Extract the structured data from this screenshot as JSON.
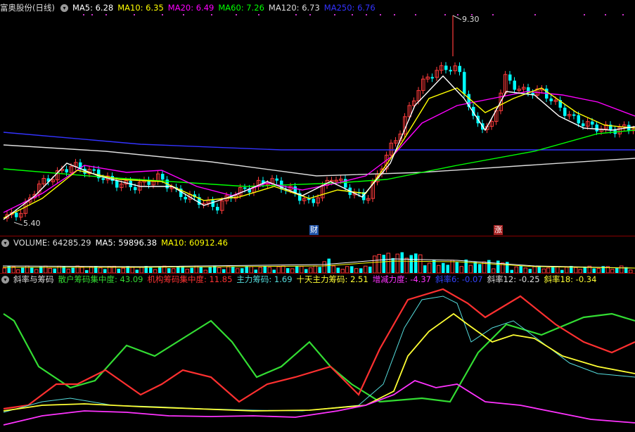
{
  "stock": {
    "title": "富奥股份(日线)"
  },
  "price_panel": {
    "toggle": "▾",
    "ma": [
      {
        "label": "MA5: 6.28",
        "color": "#ffffff"
      },
      {
        "label": "MA10: 6.35",
        "color": "#ffff00"
      },
      {
        "label": "MA20: 6.49",
        "color": "#ff00ff"
      },
      {
        "label": "MA60: 7.26",
        "color": "#00ff00"
      },
      {
        "label": "MA120: 6.73",
        "color": "#dddddd"
      },
      {
        "label": "MA250: 6.76",
        "color": "#3333ff"
      }
    ],
    "high_label": "9.30",
    "low_label": "5.40",
    "marker_cai": "财",
    "marker_zhang": "涨"
  },
  "volume_panel": {
    "label": "VOLUME: 64285.29",
    "ma5": "MA5: 59896.38",
    "ma10": "MA10: 60912.46"
  },
  "indicator_panel": {
    "name": "斜率与筹码",
    "items": [
      {
        "label": "散户筹码集中度: 43.09",
        "color": "#33dd33"
      },
      {
        "label": "机构筹码集中度: 11.85",
        "color": "#ff3030"
      },
      {
        "label": "主力筹码: 1.69",
        "color": "#55dddd"
      },
      {
        "label": "十天主力筹码: 2.51",
        "color": "#ffff33"
      },
      {
        "label": "增减力度: -4.37",
        "color": "#ff33ff"
      },
      {
        "label": "斜率6: -0.07",
        "color": "#3344ff"
      },
      {
        "label": "斜率12: -0.25",
        "color": "#dddddd"
      },
      {
        "label": "斜率18: -0.34",
        "color": "#ffff33"
      }
    ]
  },
  "colors": {
    "up": "#ff3b3b",
    "down": "#00ffff",
    "bg": "#000000",
    "grid": "#8b0000"
  }
}
